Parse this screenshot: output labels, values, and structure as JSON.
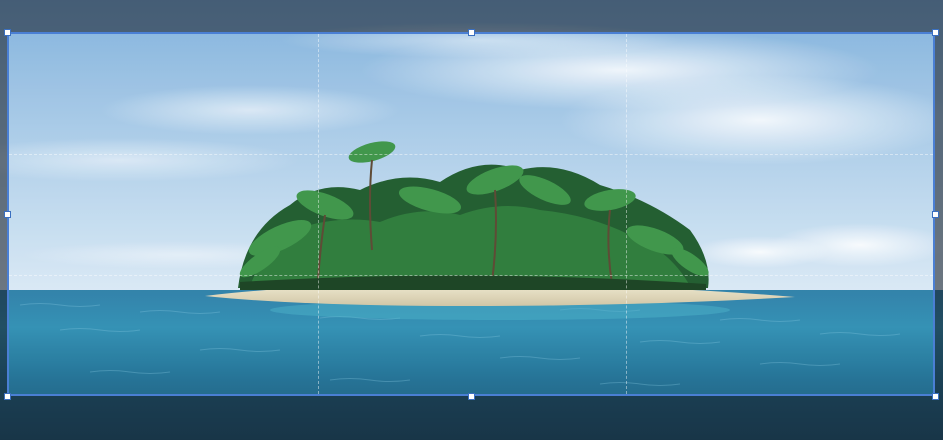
{
  "editor": {
    "mode": "crop",
    "accent_color": "#4a7fd4"
  },
  "canvas": {
    "content": "tropical-island-photo"
  },
  "crop_handles": [
    "top-left",
    "top-center",
    "top-right",
    "middle-left",
    "middle-right",
    "bottom-left",
    "bottom-center",
    "bottom-right"
  ]
}
